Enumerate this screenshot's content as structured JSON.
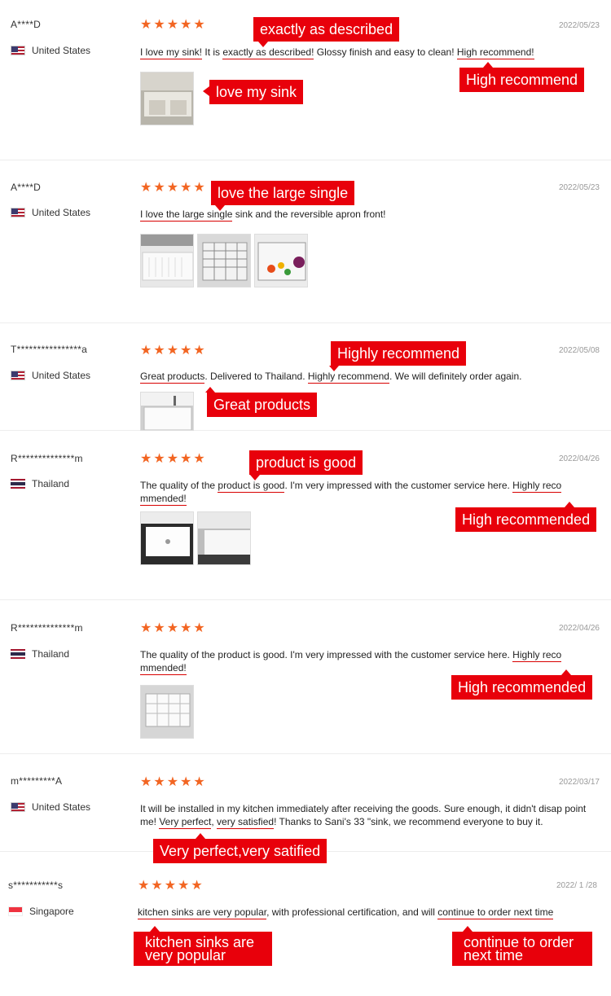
{
  "reviews": [
    {
      "user": "A****D",
      "country": "United States",
      "stars": "★★★★★",
      "date": "2022/05/23",
      "text": {
        "a": "I love my sink!",
        "b": " It is ",
        "c": "exactly as described!",
        "d": " Glossy finish and easy to clean! ",
        "e": "High recommend!"
      },
      "callouts": {
        "c1": "exactly as described",
        "c2": "High recommend",
        "c3": "love my sink"
      }
    },
    {
      "user": "A****D",
      "country": "United States",
      "stars": "★★★★★",
      "date": "2022/05/23",
      "text": {
        "a": "I love the large single",
        "b": " sink and the reversible apron front!"
      },
      "callouts": {
        "c1": "love the large single"
      }
    },
    {
      "user": "T****************a",
      "country": "United States",
      "stars": "★★★★★",
      "date": "2022/05/08",
      "text": {
        "a": "Great products",
        "b": ". Delivered to Thailand. ",
        "c": "Highly recommend",
        "d": ". We will definitely order again."
      },
      "callouts": {
        "c1": "Highly recommend",
        "c2": "Great products"
      }
    },
    {
      "user": "R**************m",
      "country": "Thailand",
      "stars": "★★★★★",
      "date": "2022/04/26",
      "text": {
        "a": "The quality of the ",
        "b": "product is good",
        "c": ". I'm very impressed with the customer service here. ",
        "d": "Highly reco mmended!"
      },
      "callouts": {
        "c1": "product is good",
        "c2": "High recommended"
      }
    },
    {
      "user": "R**************m",
      "country": "Thailand",
      "stars": "★★★★★",
      "date": "2022/04/26",
      "text": {
        "a": "The quality of the product is good. I'm very impressed with the customer service here. ",
        "b": "Highly reco mmended!"
      },
      "callouts": {
        "c1": "High recommended"
      }
    },
    {
      "user": "m*********A",
      "country": "United States",
      "stars": "★★★★★",
      "date": "2022/03/17",
      "text": {
        "a": "It will be installed in my kitchen immediately after receiving the goods. Sure enough, it didn't disap point me! ",
        "b": "Very perfect",
        "c": ", ",
        "d": "very satisfied",
        "e": "! Thanks to Sani's 33 \"sink, we recommend everyone to buy it."
      },
      "callouts": {
        "c1": "Very perfect,very satified"
      }
    },
    {
      "user": "s***********s",
      "country": "Singapore",
      "stars": "★★★★★",
      "date": "2022/ 1 /28",
      "text": {
        "a": "kitchen sinks are very popular",
        "b": ", with professional certification, and will ",
        "c": "continue to order next time"
      },
      "callouts": {
        "c1": "kitchen sinks are very popular",
        "c2": "continue to order next time"
      }
    }
  ],
  "colors": {
    "star": "#f26522",
    "callout": "#e8000b",
    "underline": "#d80000"
  },
  "icons": {
    "us": "us-flag-icon",
    "th": "thailand-flag-icon",
    "sg": "singapore-flag-icon"
  }
}
